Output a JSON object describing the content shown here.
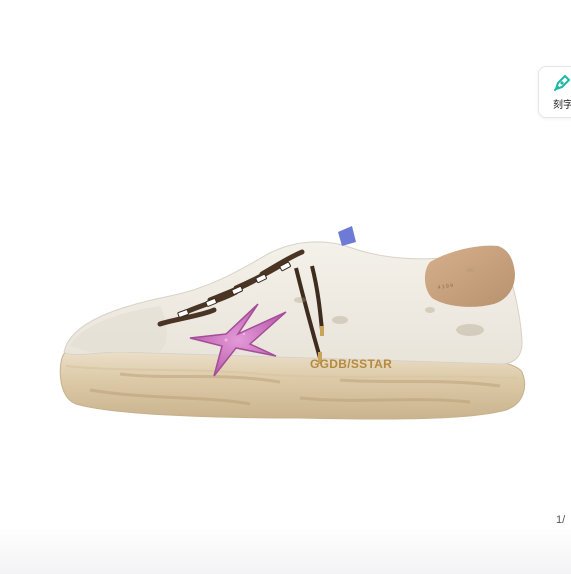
{
  "product": {
    "image_alt": "Golden Goose Super-Star sneaker with pink glitter star",
    "brand_print": "GGDB/SSTAR"
  },
  "engrave_button": {
    "label": "刻字",
    "icon": "engrave-pen-icon"
  },
  "gallery": {
    "page_indicator": "1/"
  },
  "colors": {
    "accent_teal": "#1fb7a6",
    "star_pink": "#c868b8",
    "heel_tan": "#c9a07c"
  }
}
